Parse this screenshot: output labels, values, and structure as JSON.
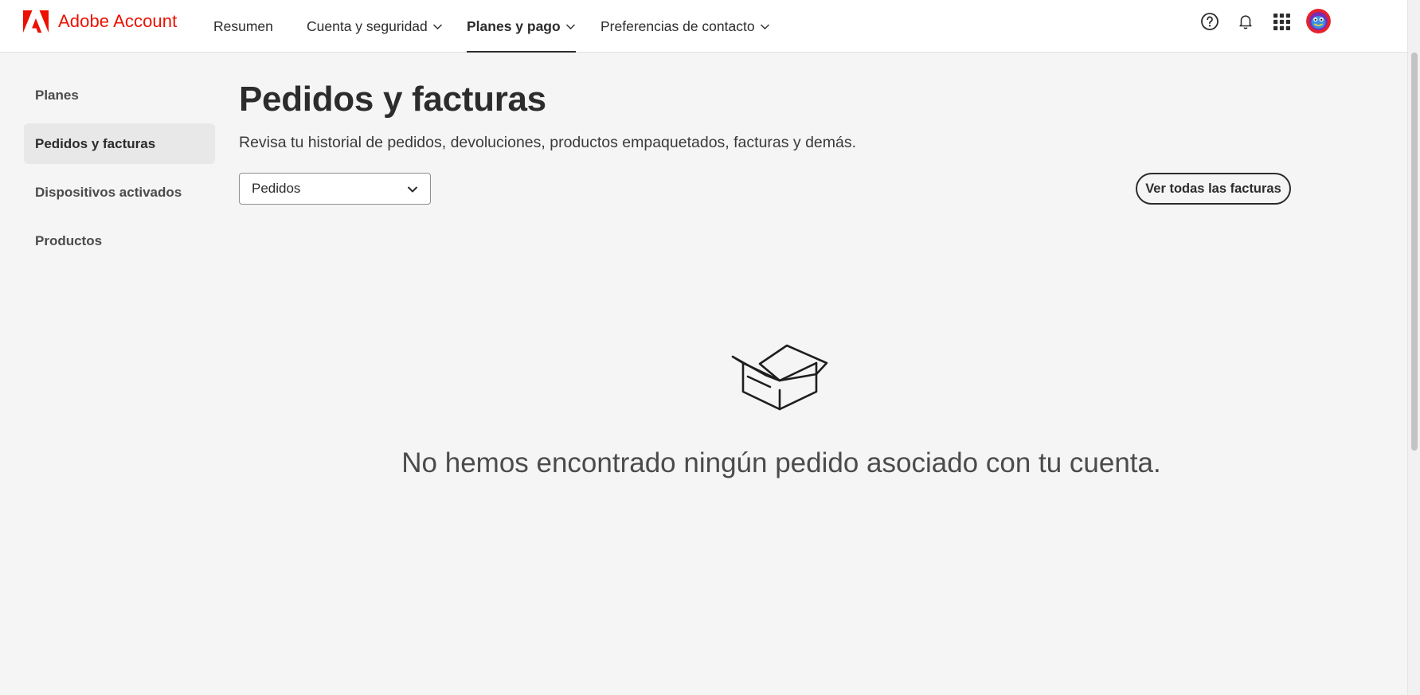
{
  "header": {
    "brand_name": "Adobe Account",
    "brand_color": "#eb1000",
    "nav": [
      {
        "label": "Resumen",
        "has_dropdown": false,
        "active": false
      },
      {
        "label": "Cuenta y seguridad",
        "has_dropdown": true,
        "active": false
      },
      {
        "label": "Planes y pago",
        "has_dropdown": true,
        "active": true
      },
      {
        "label": "Preferencias de contacto",
        "has_dropdown": true,
        "active": false
      }
    ],
    "icons": [
      "help-icon",
      "bell-icon",
      "apps-grid-icon",
      "avatar"
    ]
  },
  "sidebar": {
    "items": [
      {
        "label": "Planes",
        "active": false
      },
      {
        "label": "Pedidos y facturas",
        "active": true
      },
      {
        "label": "Dispositivos activados",
        "active": false
      },
      {
        "label": "Productos",
        "active": false
      }
    ]
  },
  "main": {
    "title": "Pedidos y facturas",
    "description": "Revisa tu historial de pedidos, devoluciones, productos empaquetados, facturas y demás.",
    "filter": {
      "selected": "Pedidos"
    },
    "view_all_invoices_label": "Ver todas las facturas",
    "empty_state": {
      "icon": "open-box-icon",
      "message": "No hemos encontrado ningún pedido asociado con tu cuenta."
    }
  }
}
